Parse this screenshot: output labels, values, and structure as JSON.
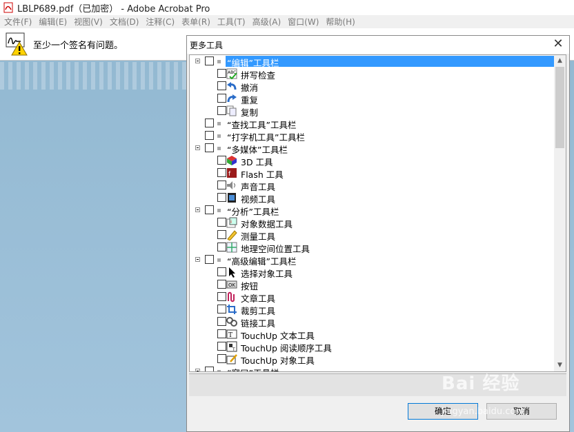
{
  "window": {
    "title": "LBLP689.pdf（已加密） - Adobe Acrobat Pro"
  },
  "menu": [
    "文件(F)",
    "编辑(E)",
    "视图(V)",
    "文档(D)",
    "注释(C)",
    "表单(R)",
    "工具(T)",
    "高级(A)",
    "窗口(W)",
    "帮助(H)"
  ],
  "notification": {
    "text": "至少一个签名有问题。"
  },
  "dialog": {
    "title": "更多工具",
    "close_symbol": "✕",
    "ok_label": "确定",
    "cancel_label": "取消",
    "scroll_up": "▲",
    "scroll_down": "▼"
  },
  "tree": [
    {
      "level": 0,
      "label": "“编辑”工具栏",
      "expanded": true,
      "selected": true
    },
    {
      "level": 1,
      "label": "拼写检查",
      "icon": "spellcheck-icon"
    },
    {
      "level": 1,
      "label": "撤消",
      "icon": "undo-icon"
    },
    {
      "level": 1,
      "label": "重复",
      "icon": "redo-icon"
    },
    {
      "level": 1,
      "label": "复制",
      "icon": "copy-icon"
    },
    {
      "level": 0,
      "label": "“查找工具”工具栏",
      "expanded": false
    },
    {
      "level": 0,
      "label": "“打字机工具”工具栏",
      "expanded": false
    },
    {
      "level": 0,
      "label": "“多媒体”工具栏",
      "expanded": true
    },
    {
      "level": 1,
      "label": "3D 工具",
      "icon": "3d-icon"
    },
    {
      "level": 1,
      "label": "Flash 工具",
      "icon": "flash-icon"
    },
    {
      "level": 1,
      "label": "声音工具",
      "icon": "sound-icon"
    },
    {
      "level": 1,
      "label": "视频工具",
      "icon": "video-icon"
    },
    {
      "level": 0,
      "label": "“分析”工具栏",
      "expanded": true
    },
    {
      "level": 1,
      "label": "对象数据工具",
      "icon": "object-data-icon"
    },
    {
      "level": 1,
      "label": "测量工具",
      "icon": "ruler-icon"
    },
    {
      "level": 1,
      "label": "地理空间位置工具",
      "icon": "geospatial-icon"
    },
    {
      "level": 0,
      "label": "“高级编辑”工具栏",
      "expanded": true
    },
    {
      "level": 1,
      "label": "选择对象工具",
      "icon": "cursor-icon"
    },
    {
      "level": 1,
      "label": "按钮",
      "icon": "ok-button-icon"
    },
    {
      "level": 1,
      "label": "文章工具",
      "icon": "article-icon"
    },
    {
      "level": 1,
      "label": "裁剪工具",
      "icon": "crop-icon"
    },
    {
      "level": 1,
      "label": "链接工具",
      "icon": "link-icon"
    },
    {
      "level": 1,
      "label": "TouchUp 文本工具",
      "icon": "touchup-text-icon"
    },
    {
      "level": 1,
      "label": "TouchUp 阅读顺序工具",
      "icon": "touchup-order-icon"
    },
    {
      "level": 1,
      "label": "TouchUp 对象工具",
      "icon": "touchup-object-icon"
    },
    {
      "level": 0,
      "label": "“窗口”工具栏",
      "expanded": true
    }
  ],
  "watermark": {
    "text": "Bai 经验",
    "sub": "jingyan.baidu.com"
  },
  "colors": {
    "selection": "#3399ff",
    "backdrop": "#9cc0d8"
  }
}
